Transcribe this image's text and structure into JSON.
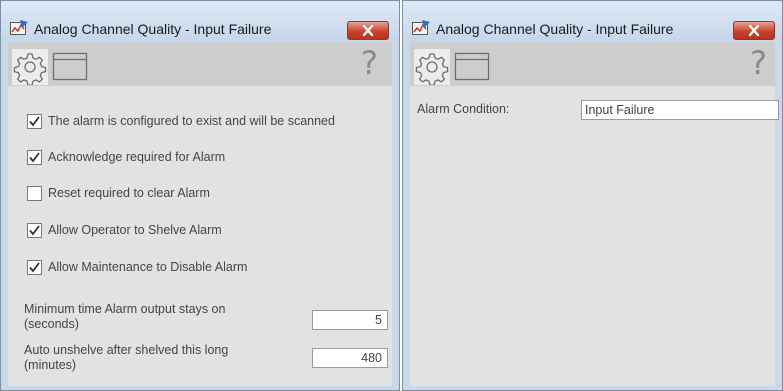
{
  "windows": [
    {
      "title": "Analog Channel Quality - Input Failure",
      "toolbar": {
        "icons": [
          "gear-icon",
          "window-icon",
          "help-icon"
        ],
        "help_glyph": "?"
      },
      "checkboxes": [
        {
          "label": "The alarm is configured to exist and will be scanned",
          "checked": true
        },
        {
          "label": "Acknowledge required for Alarm",
          "checked": true
        },
        {
          "label": "Reset required to clear Alarm",
          "checked": false
        },
        {
          "label": "Allow Operator to Shelve Alarm",
          "checked": true
        },
        {
          "label": "Allow Maintenance to Disable Alarm",
          "checked": true
        }
      ],
      "fields": [
        {
          "label_line1": "Minimum time Alarm output stays on",
          "label_line2": "(seconds)",
          "value": "5"
        },
        {
          "label_line1": "Auto unshelve after shelved this long",
          "label_line2": "(minutes)",
          "value": "480"
        }
      ]
    },
    {
      "title": "Analog Channel Quality - Input Failure",
      "toolbar": {
        "icons": [
          "gear-icon",
          "window-icon",
          "help-icon"
        ],
        "help_glyph": "?"
      },
      "alarm_condition": {
        "label": "Alarm Condition:",
        "value": "Input Failure"
      }
    }
  ],
  "colors": {
    "title_bar": "#c9d8ea",
    "close_button": "#c8432d",
    "panel_bg": "#e2e2e2",
    "toolbar_bg": "#cdcdcd"
  }
}
